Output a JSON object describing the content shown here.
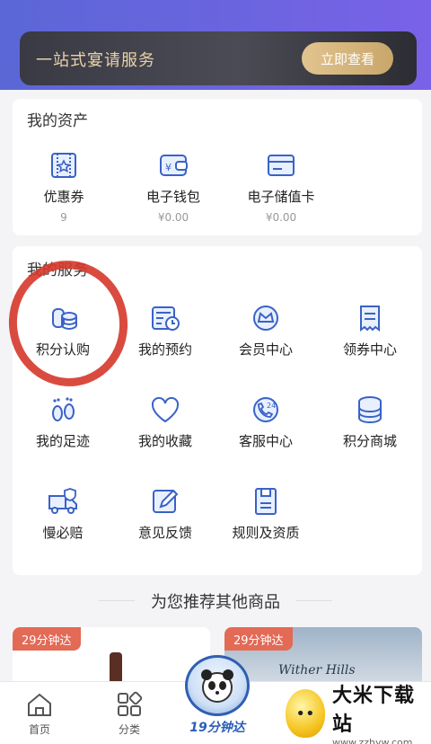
{
  "banner": {
    "title": "一站式宴请服务",
    "button": "立即查看"
  },
  "assets": {
    "title": "我的资产",
    "items": [
      {
        "label": "优惠券",
        "value": "9",
        "icon": "coupon-icon"
      },
      {
        "label": "电子钱包",
        "value": "¥0.00",
        "icon": "wallet-icon"
      },
      {
        "label": "电子储值卡",
        "value": "¥0.00",
        "icon": "card-icon"
      }
    ]
  },
  "services": {
    "title": "我的服务",
    "items": [
      {
        "label": "积分认购",
        "icon": "points-purchase-icon"
      },
      {
        "label": "我的预约",
        "icon": "reservation-icon"
      },
      {
        "label": "会员中心",
        "icon": "member-crown-icon"
      },
      {
        "label": "领券中心",
        "icon": "coupon-center-icon"
      },
      {
        "label": "我的足迹",
        "icon": "footprint-icon"
      },
      {
        "label": "我的收藏",
        "icon": "heart-icon"
      },
      {
        "label": "客服中心",
        "icon": "phone-24-icon"
      },
      {
        "label": "积分商城",
        "icon": "coins-stack-icon"
      },
      {
        "label": "慢必赔",
        "icon": "delivery-truck-icon"
      },
      {
        "label": "意见反馈",
        "icon": "edit-icon"
      },
      {
        "label": "规则及资质",
        "icon": "document-icon"
      }
    ]
  },
  "recommend": {
    "title": "为您推荐其他商品"
  },
  "products": [
    {
      "tag": "29分钟达"
    },
    {
      "tag": "29分钟达",
      "brand_text": "Wither Hills"
    }
  ],
  "tabbar": {
    "home": "首页",
    "category": "分类",
    "center": "19分钟达"
  },
  "watermark": {
    "name": "大米下载站",
    "url": "www.zzhyw.com"
  },
  "colors": {
    "accent": "#2b5db8",
    "annotation_circle": "#d6372a",
    "tag": "#e36a55"
  }
}
